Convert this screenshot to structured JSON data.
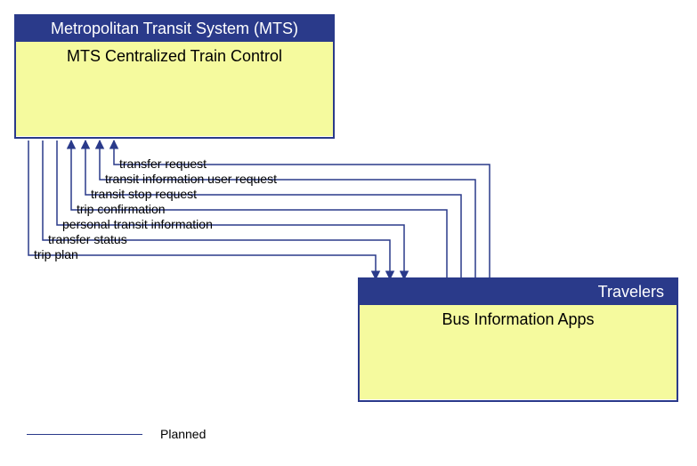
{
  "nodes": {
    "mts": {
      "header": "Metropolitan Transit System (MTS)",
      "body": "MTS Centralized Train Control"
    },
    "travelers": {
      "header": "Travelers",
      "body": "Bus Information Apps"
    }
  },
  "flows": {
    "to_mts": [
      "transfer request",
      "transit information user request",
      "transit stop request",
      "trip confirmation"
    ],
    "to_travelers": [
      "personal transit information",
      "transfer status",
      "trip plan"
    ]
  },
  "legend": {
    "label": "Planned"
  },
  "colors": {
    "primary": "#2a3a8a",
    "fill": "#f5fa9e"
  }
}
